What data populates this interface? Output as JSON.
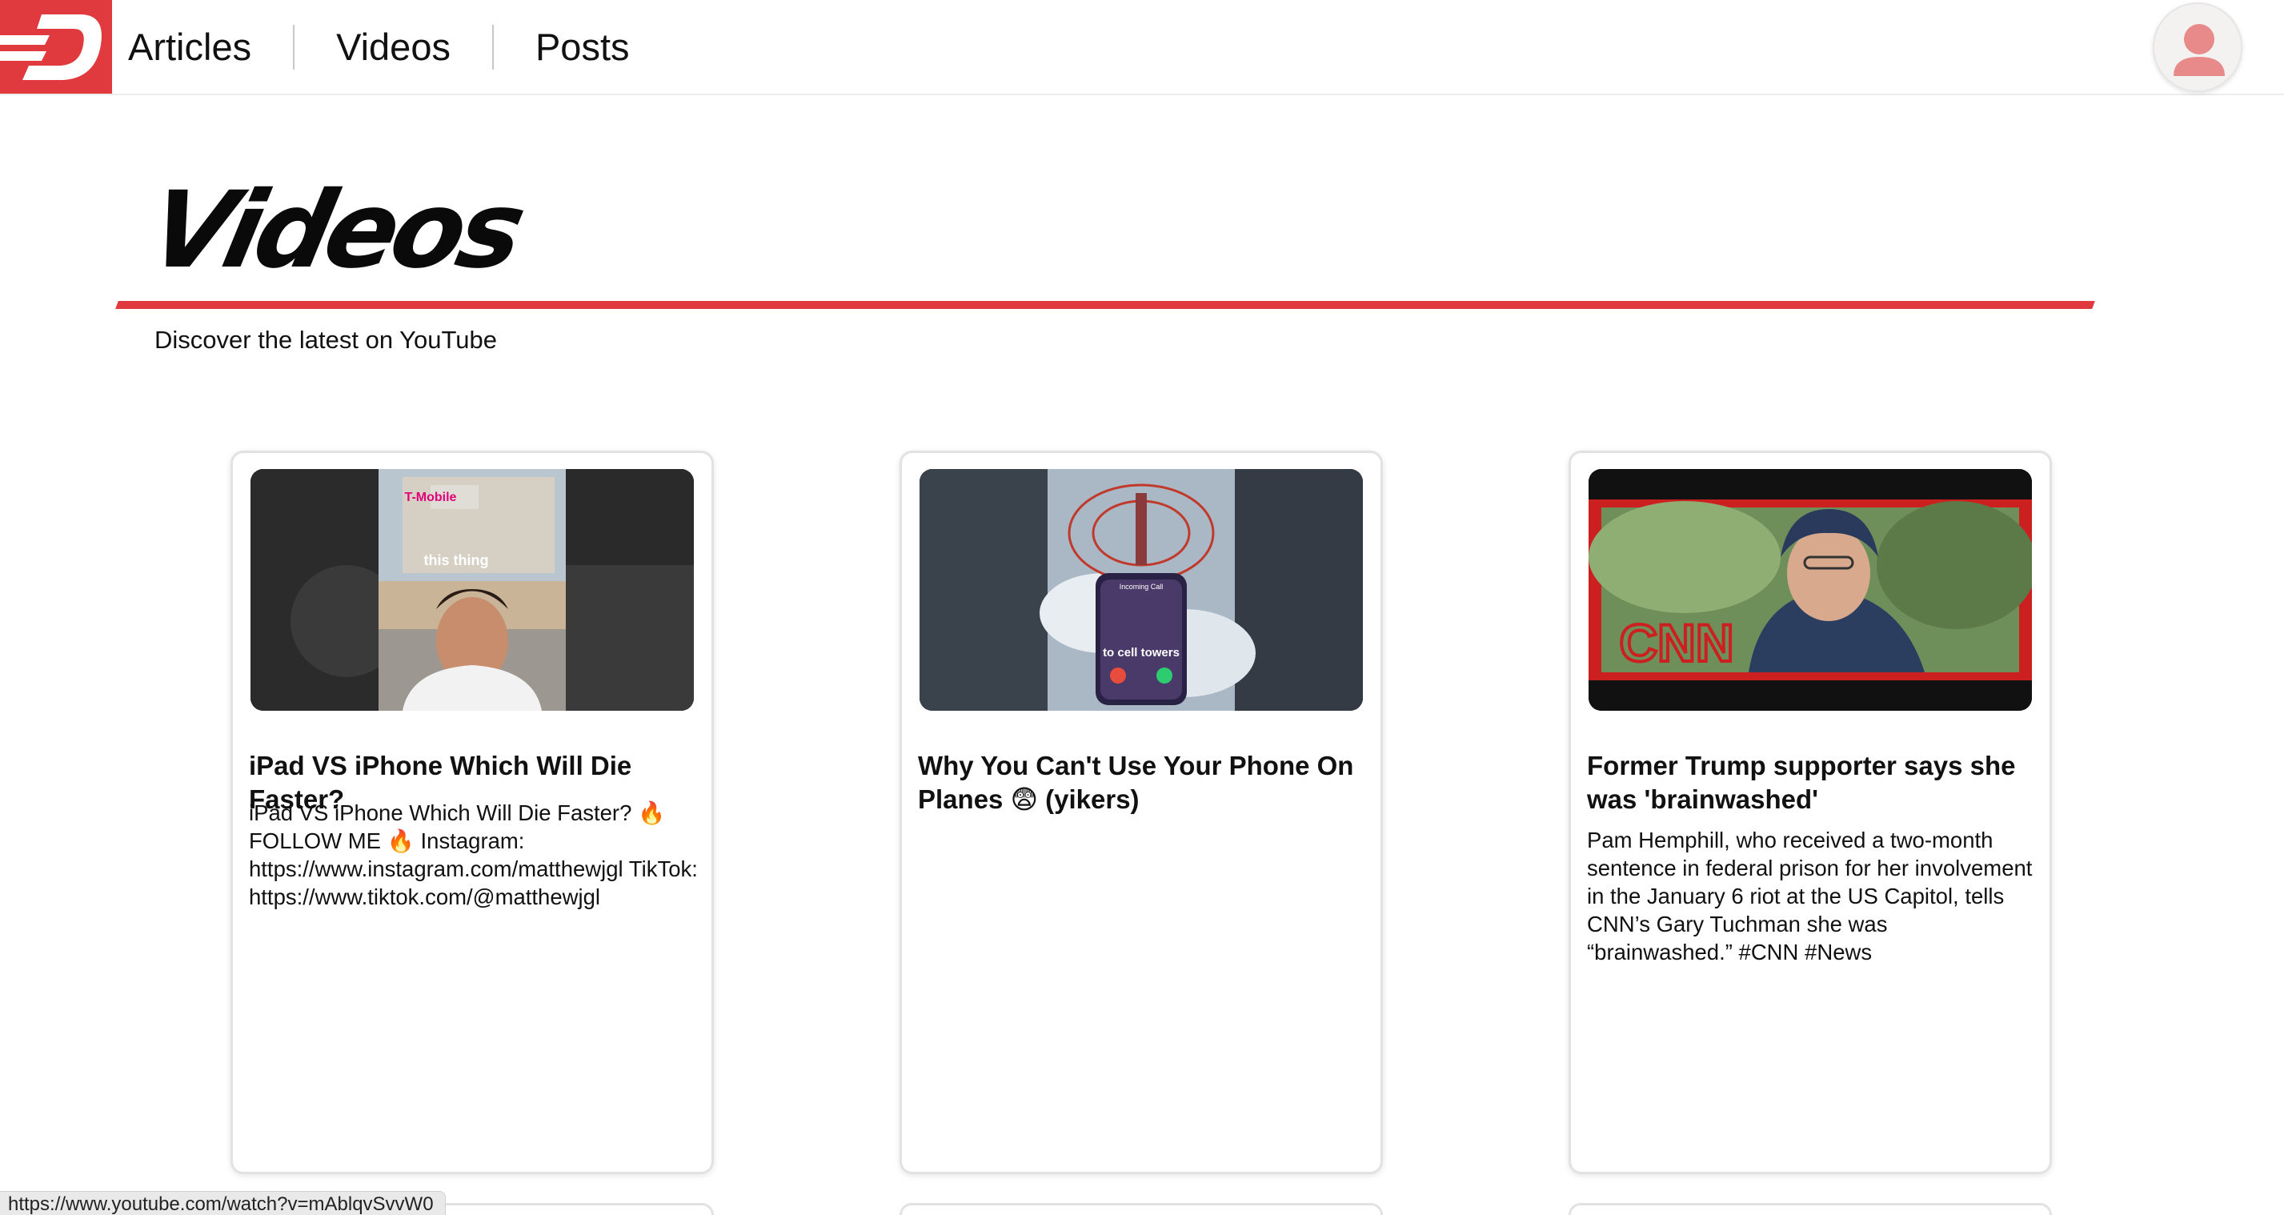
{
  "nav": {
    "items": [
      {
        "label": "Articles"
      },
      {
        "label": "Videos"
      },
      {
        "label": "Posts"
      }
    ]
  },
  "page": {
    "title": "Videos",
    "subtitle": "Discover the latest on YouTube"
  },
  "cards": [
    {
      "title": "iPad VS iPhone Which Will Die Faster?",
      "description": "iPad VS iPhone Which Will Die Faster? 🔥 FOLLOW ME 🔥 Instagram: https://www.instagram.com/matthewjgl TikTok: https://www.tiktok.com/@matthewjgl",
      "thumb_caption": "this thing",
      "thumb_sign": "T-Mobile"
    },
    {
      "title": "Why You Can't Use Your Phone On Planes 😨 (yikers)",
      "description": "",
      "thumb_call_label": "Incoming Call",
      "thumb_caption": "to cell towers"
    },
    {
      "title": "Former Trump supporter says she was 'brainwashed'",
      "description": "Pam Hemphill, who received a two-month sentence in federal prison for her involvement in the January 6 riot at the US Capitol, tells CNN’s Gary Tuchman she was “brainwashed.” #CNN #News",
      "thumb_logo": "CNN"
    }
  ],
  "status_bar": {
    "url": "https://www.youtube.com/watch?v=mAblqvSvvW0"
  },
  "colors": {
    "brand_red": "#e03a3e",
    "avatar_pink": "#e88a8a"
  }
}
